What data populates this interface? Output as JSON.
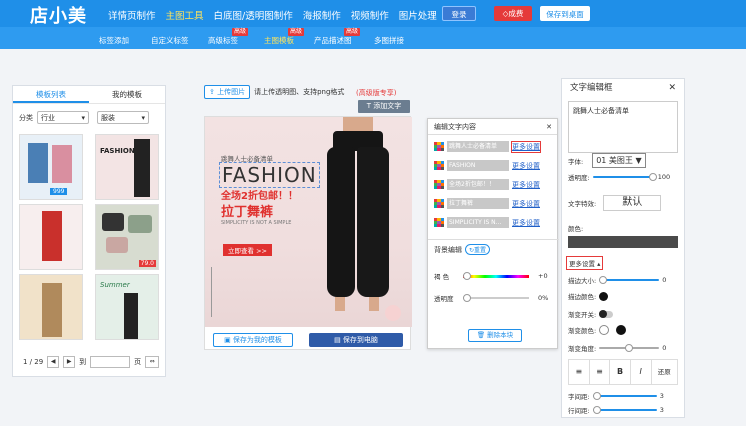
{
  "header": {
    "logo": "店小美",
    "nav": [
      "详情页制作",
      "主图工具",
      "白底图/透明图制作",
      "海报制作",
      "视频制作",
      "图片处理"
    ],
    "login": "登录",
    "vip": "◇成费",
    "save_desktop": "保存到桌面"
  },
  "subnav": {
    "items": [
      "标签添加",
      "自定义标签",
      "高级标签",
      "主图模板",
      "产品描述图",
      "多图拼接"
    ],
    "tags": [
      "高级",
      "高级",
      "高级"
    ]
  },
  "left_panel": {
    "tab_templates": "模板列表",
    "tab_mine": "我的模板",
    "filter_label": "分类",
    "filter_category": "行业",
    "filter_sub": "服装",
    "pager_text": "1 / 29",
    "to_label": "到",
    "page_label": "页",
    "go": "⇔"
  },
  "thumbs": {
    "t1_price": "999",
    "t2_title": "FASHION",
    "t4_price": "79.0",
    "t6_title": "Summer"
  },
  "canvas": {
    "upload_btn": "上传图片",
    "upload_hint": "请上传透明图、支持png格式",
    "vip_hint": "(高级版专享)",
    "add_text": "T 添加文字",
    "small_title": "跳舞人士必备清单",
    "big_title": "FASHION",
    "promo": "全场2折包邮！！",
    "product": "拉丁舞裤",
    "slogan": "SIMPLICITY IS NOT A SIMPLE",
    "cta": "立即查看 >>",
    "save_template": "保存为我的模板",
    "save_pc": "保存到电脑"
  },
  "edit_panel": {
    "title": "编辑文字内容",
    "rows": [
      "跳舞人士必备清单",
      "FASHION",
      "全场2折包邮！！",
      "拉丁舞裤",
      "SIMPLICITY IS N..."
    ],
    "more": "更多设置",
    "bg_edit": "背景编辑",
    "reset": "重置",
    "hue_label": "褐  色",
    "hue_val": "+0",
    "opacity_label": "透明度",
    "opacity_val": "0%",
    "delete": "删除本块"
  },
  "right_panel": {
    "title": "文字编辑框",
    "text_value": "跳舞人士必备清单",
    "font_label": "字体:",
    "font_value": "01 美图王 ▼",
    "opacity_label": "透明度:",
    "opacity_val": "100",
    "effect_label": "文字特效:",
    "effect_value": "默认",
    "color_label": "颜色:",
    "more_settings": "更多设置 ▴",
    "stroke_size": "描边大小:",
    "stroke_size_val": "0",
    "stroke_color": "描边颜色:",
    "gradient_toggle": "渐变开关:",
    "gradient_color": "渐变颜色:",
    "gradient_angle": "渐变角度:",
    "gradient_angle_val": "0",
    "reset": "还原",
    "letter_spacing": "字间距:",
    "letter_spacing_val": "3",
    "line_spacing": "行间距:",
    "line_spacing_val": "3"
  },
  "colors": {
    "primary": "#1f8fe8",
    "accent_red": "#e53a3a",
    "highlight": "#ffe45c"
  }
}
